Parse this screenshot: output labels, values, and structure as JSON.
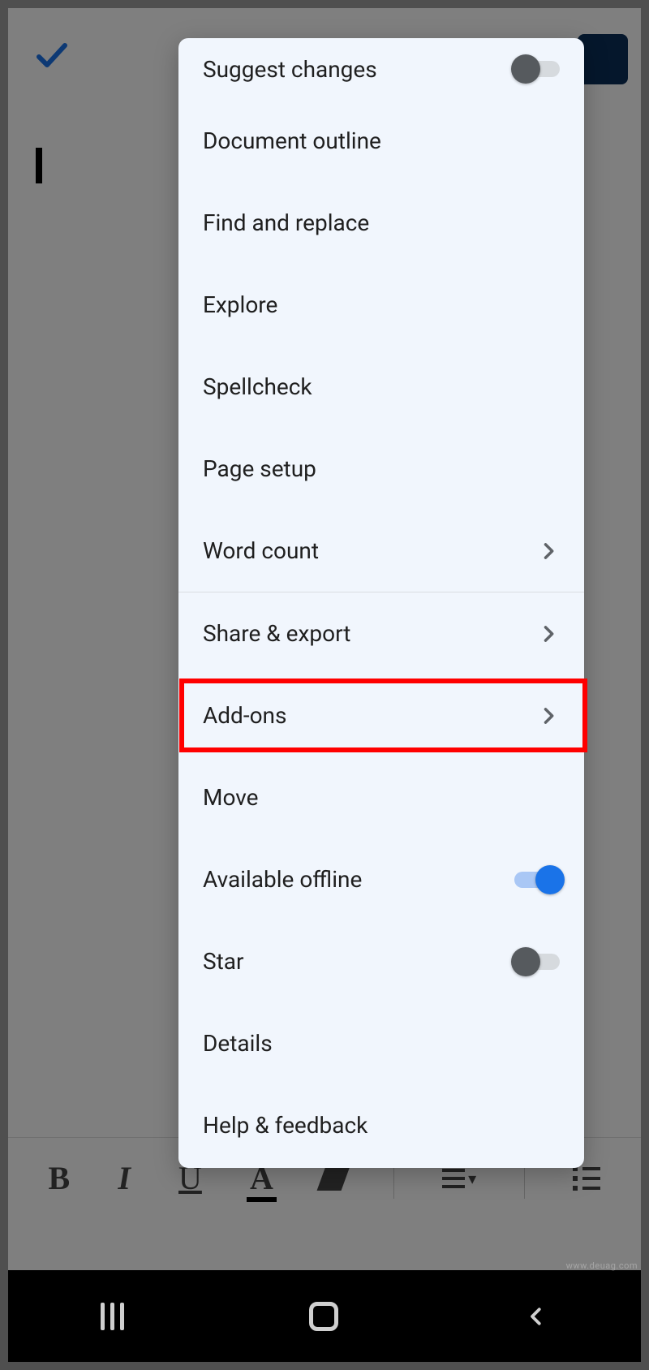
{
  "menu": {
    "items": [
      {
        "label": "Suggest changes",
        "type": "toggle",
        "on": false
      },
      {
        "label": "Document outline",
        "type": "plain"
      },
      {
        "label": "Find and replace",
        "type": "plain"
      },
      {
        "label": "Explore",
        "type": "plain"
      },
      {
        "label": "Spellcheck",
        "type": "plain"
      },
      {
        "label": "Page setup",
        "type": "plain"
      },
      {
        "label": "Word count",
        "type": "chevron"
      },
      {
        "label": "Share & export",
        "type": "chevron"
      },
      {
        "label": "Add-ons",
        "type": "chevron",
        "highlighted": true
      },
      {
        "label": "Move",
        "type": "plain"
      },
      {
        "label": "Available offline",
        "type": "toggle",
        "on": true
      },
      {
        "label": "Star",
        "type": "toggle",
        "on": false
      },
      {
        "label": "Details",
        "type": "plain"
      },
      {
        "label": "Help & feedback",
        "type": "plain"
      }
    ]
  },
  "toolbar": {
    "bold": "B",
    "italic": "I",
    "underline": "U",
    "textcolor": "A"
  },
  "watermark": "www.deuag.com"
}
